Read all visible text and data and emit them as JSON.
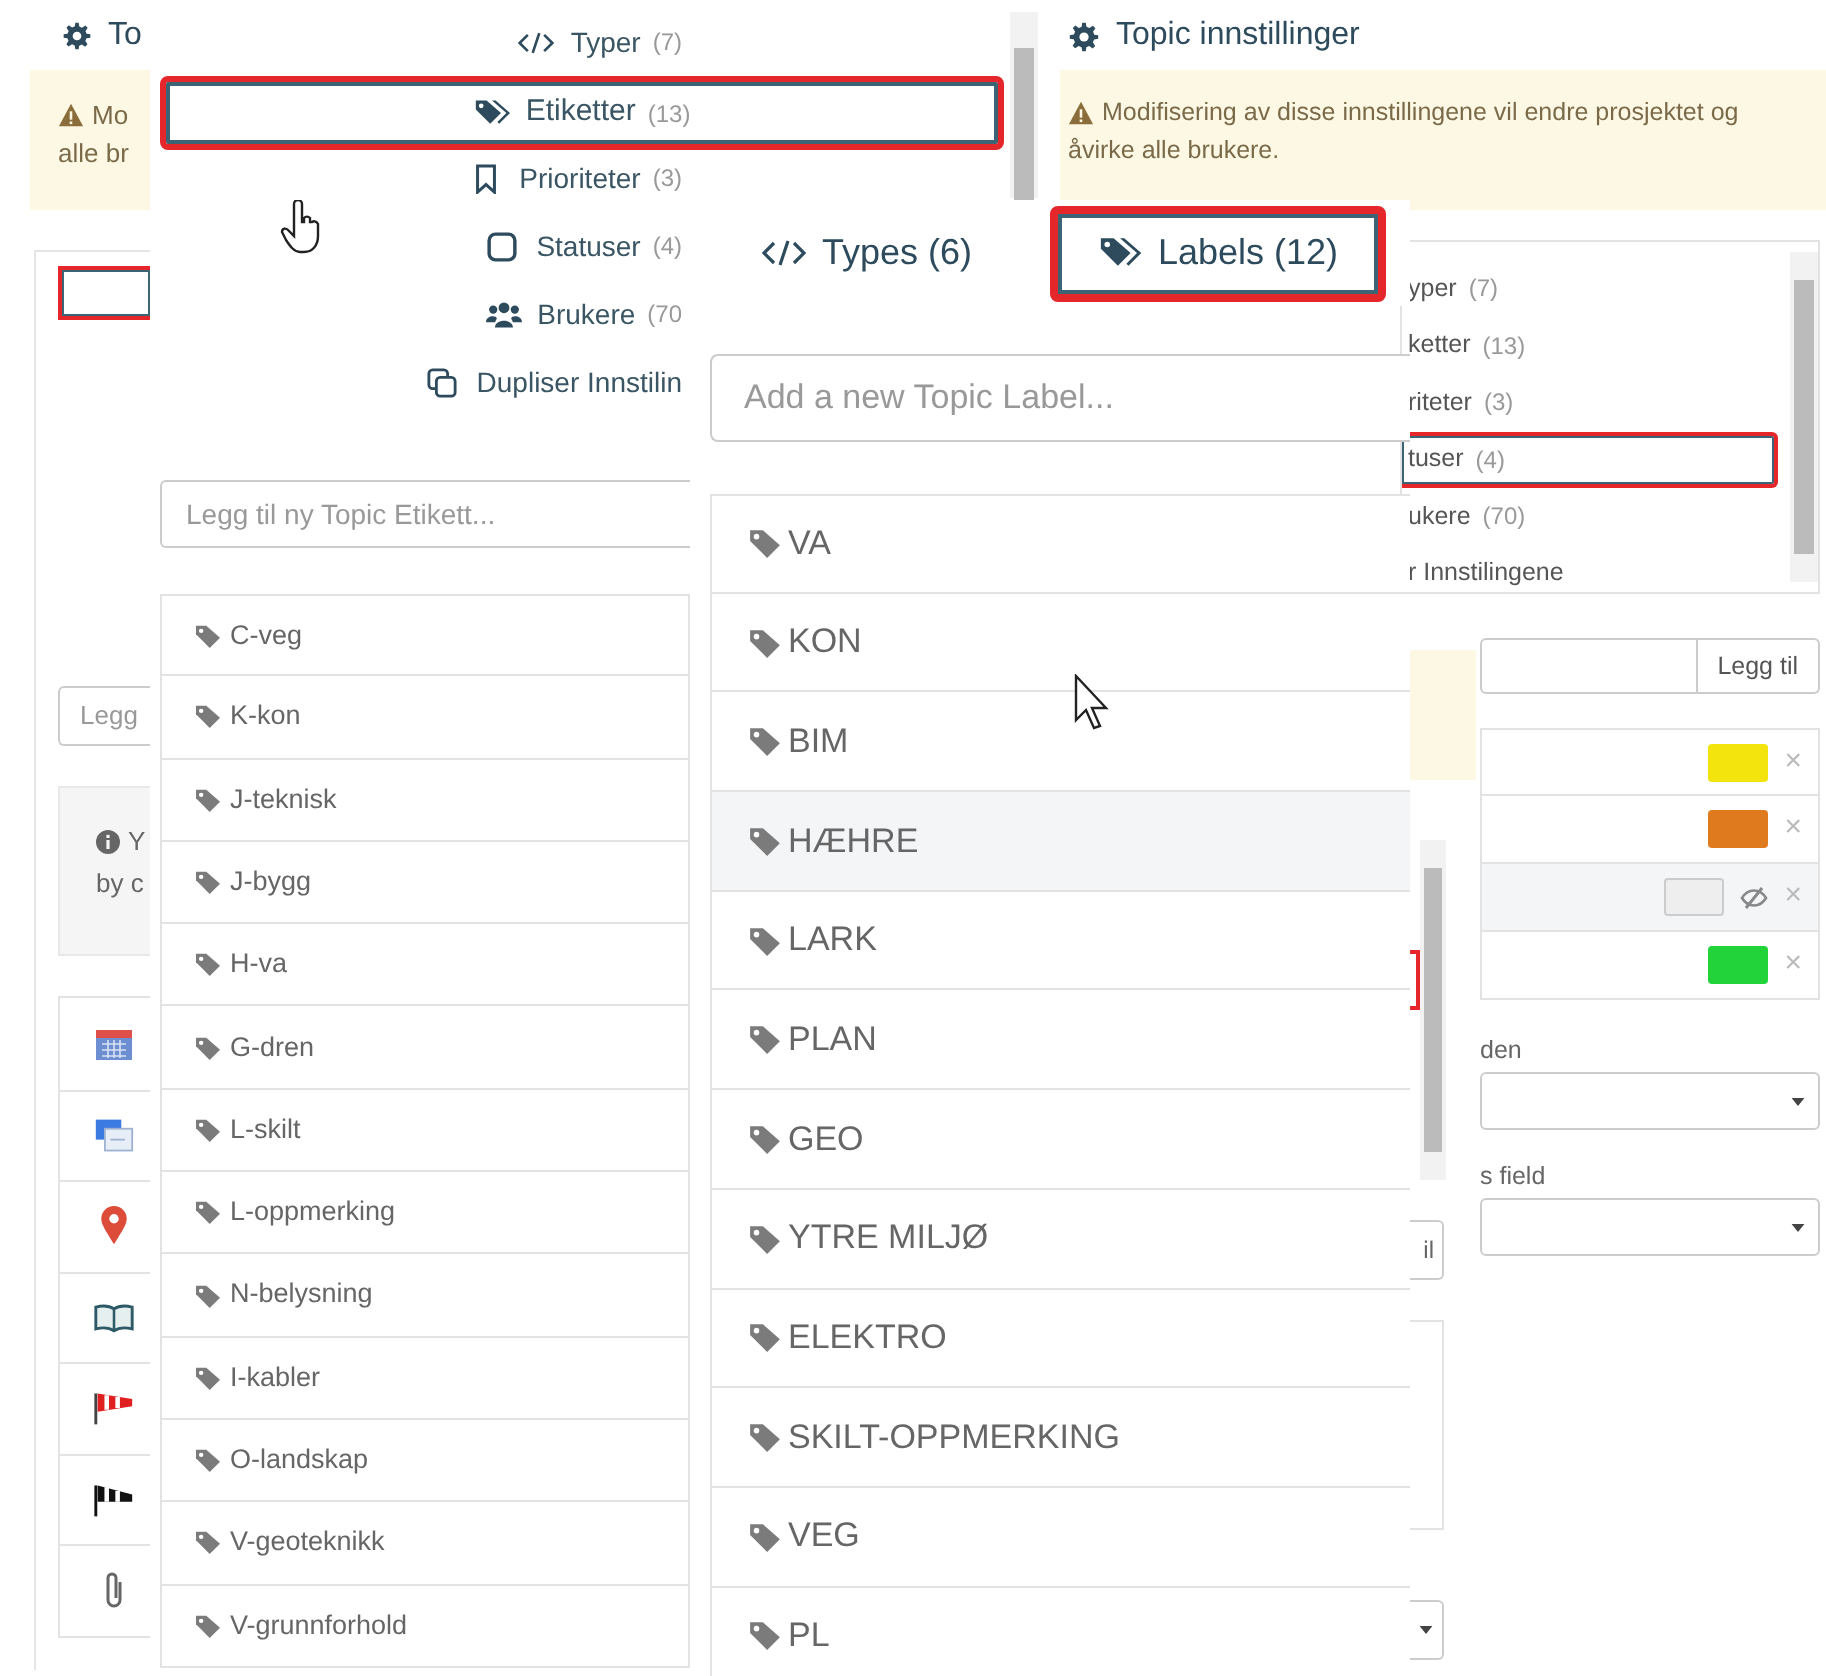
{
  "left_panel": {
    "title": "To",
    "warning_lines": [
      "Mo",
      "alle br"
    ],
    "field_placeholder": "Legg",
    "info_lines": [
      "Y",
      "by c"
    ]
  },
  "middle_panel": {
    "menu": [
      {
        "kind": "types",
        "label": "Typer",
        "count": "(7)",
        "selected": false
      },
      {
        "kind": "labels",
        "label": "Etiketter",
        "count": "(13)",
        "selected": true
      },
      {
        "kind": "priorities",
        "label": "Prioriteter",
        "count": "(3)",
        "selected": false
      },
      {
        "kind": "statuses",
        "label": "Statuser",
        "count": "(4)",
        "selected": false
      },
      {
        "kind": "users",
        "label": "Brukere",
        "count": "(70",
        "selected": false
      },
      {
        "kind": "duplicate",
        "label": "Dupliser Innstilin",
        "selected": false
      }
    ],
    "placeholder": "Legg til ny Topic Etikett...",
    "labels": [
      "C-veg",
      "K-kon",
      "J-teknisk",
      "J-bygg",
      "H-va",
      "G-dren",
      "L-skilt",
      "L-oppmerking",
      "N-belysning",
      "I-kabler",
      "O-landskap",
      "V-geoteknikk",
      "V-grunnforhold"
    ]
  },
  "right_panel": {
    "title": "Topic innstillinger",
    "warning_lines": [
      "Modifisering av disse innstillingene vil endre prosjektet og",
      "åvirke alle brukere."
    ],
    "menu": [
      {
        "label": "yper",
        "count": "(7)",
        "selected": false
      },
      {
        "label": "ketter",
        "count": "(13)",
        "selected": false
      },
      {
        "label": "riteter",
        "count": "(3)",
        "selected": false
      },
      {
        "label": "tuser",
        "count": "(4)",
        "selected": true
      },
      {
        "label": "ukere",
        "count": "(70)",
        "selected": false
      },
      {
        "label": "r Innstilingene",
        "selected": false
      }
    ],
    "add_button": "Legg til",
    "labels": [
      {
        "color": "#f2e40c",
        "hidden": false,
        "remove": "×"
      },
      {
        "color": "#e07a1f",
        "hidden": false,
        "remove": "×"
      },
      {
        "color": "#eeeeee",
        "hidden": true,
        "remove": "×"
      },
      {
        "color": "#22d43a",
        "hidden": false,
        "remove": "×"
      }
    ],
    "fields": [
      {
        "label": "den"
      },
      {
        "label": "s field"
      }
    ]
  },
  "partial_panel": {
    "button": "il"
  },
  "labels_panel": {
    "tabs": [
      {
        "kind": "types",
        "label": "Types (6)",
        "selected": false
      },
      {
        "kind": "labels",
        "label": "Labels (12)",
        "selected": true
      }
    ],
    "placeholder": "Add a new Topic Label...",
    "labels": [
      {
        "name": "VA",
        "hovered": false
      },
      {
        "name": "KON",
        "hovered": false
      },
      {
        "name": "BIM",
        "hovered": false
      },
      {
        "name": "HÆHRE",
        "hovered": true
      },
      {
        "name": "LARK",
        "hovered": false
      },
      {
        "name": "PLAN",
        "hovered": false
      },
      {
        "name": "GEO",
        "hovered": false
      },
      {
        "name": "YTRE MILJØ",
        "hovered": false
      },
      {
        "name": "ELEKTRO",
        "hovered": false
      },
      {
        "name": "SKILT-OPPMERKING",
        "hovered": false
      },
      {
        "name": "VEG",
        "hovered": false
      },
      {
        "name": "PL",
        "hovered": false
      }
    ]
  }
}
